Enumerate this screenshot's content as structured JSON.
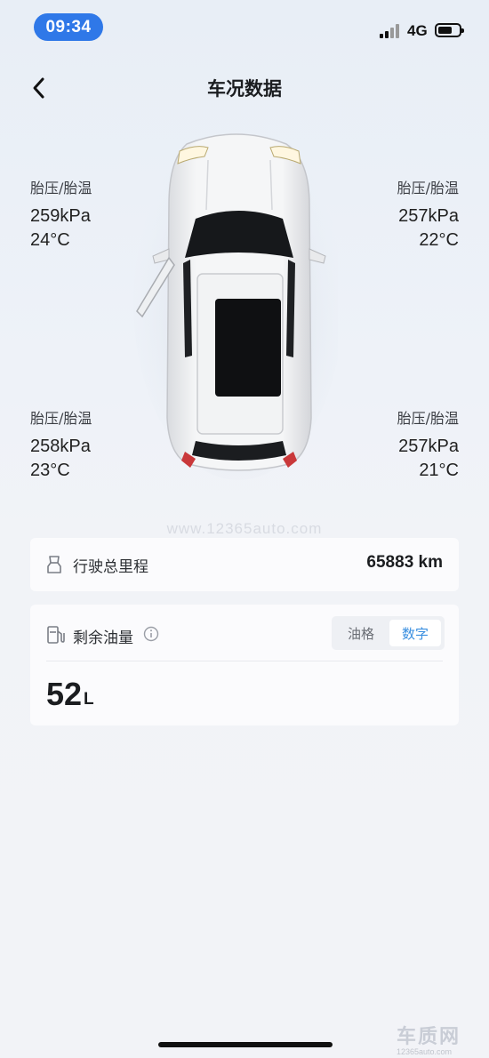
{
  "status": {
    "time": "09:34",
    "network": "4G"
  },
  "header": {
    "title": "车况数据"
  },
  "tires": {
    "front_left": {
      "label": "胎压/胎温",
      "pressure": "259kPa",
      "temp": "24°C"
    },
    "front_right": {
      "label": "胎压/胎温",
      "pressure": "257kPa",
      "temp": "22°C"
    },
    "rear_left": {
      "label": "胎压/胎温",
      "pressure": "258kPa",
      "temp": "23°C"
    },
    "rear_right": {
      "label": "胎压/胎温",
      "pressure": "257kPa",
      "temp": "21°C"
    }
  },
  "watermark": "www.12365auto.com",
  "mileage": {
    "label": "行驶总里程",
    "value": "65883 km",
    "icon": "odometer-icon"
  },
  "fuel": {
    "label": "剩余油量",
    "icon": "fuel-pump-icon",
    "toggle": {
      "option1": "油格",
      "option2": "数字",
      "selected": "数字"
    },
    "value": "52",
    "unit": "L"
  },
  "corner_logo": {
    "text": "车质网",
    "url": "12365auto.com"
  },
  "colors": {
    "accent": "#2f78e8",
    "toggle_active": "#3a8fe0",
    "background": "#eef2f8"
  }
}
